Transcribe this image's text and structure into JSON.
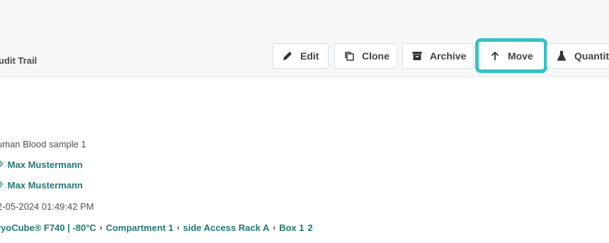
{
  "tabs": {
    "audit_trail": "udit Trail"
  },
  "toolbar": {
    "edit": "Edit",
    "clone": "Clone",
    "archive": "Archive",
    "move": "Move",
    "quantity": "Quantit"
  },
  "details": {
    "name": "uman Blood sample 1",
    "owner": "Max Mustermann",
    "creator": "Max Mustermann",
    "date": "2-05-2024 01:49:42 PM",
    "location": [
      "ryoCube® F740 | -80°C",
      "Compartment 1",
      "side Access Rack A",
      "Box 1",
      "2"
    ]
  },
  "colors": {
    "accent": "#1e7a77",
    "highlight": "#34c1c5"
  }
}
